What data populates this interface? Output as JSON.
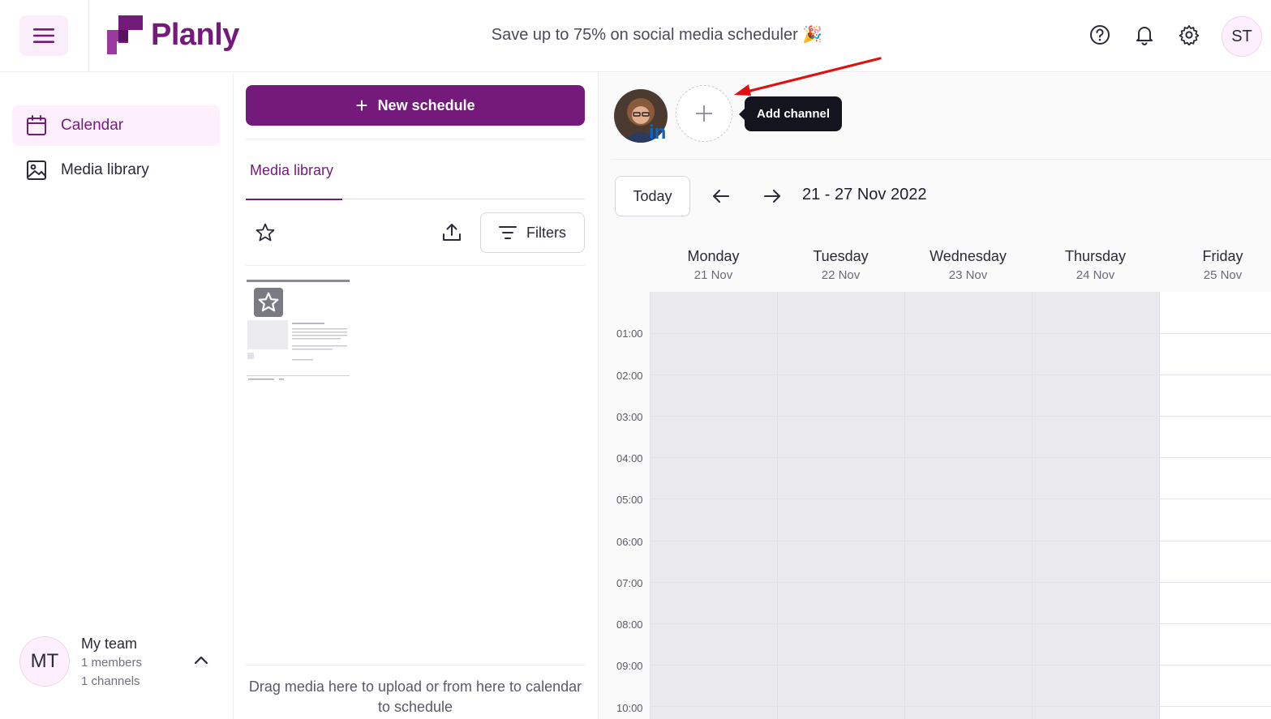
{
  "header": {
    "logo_text": "Planly",
    "promo_text": "Save up to 75% on social media scheduler 🎉",
    "user_initials": "ST",
    "icons": [
      "menu-icon",
      "help-icon",
      "bell-icon",
      "gear-icon"
    ]
  },
  "sidebar": {
    "items": [
      {
        "label": "Calendar",
        "icon": "calendar-icon",
        "active": true
      },
      {
        "label": "Media library",
        "icon": "image-icon",
        "active": false
      }
    ],
    "team": {
      "initials": "MT",
      "name": "My team",
      "members": "1 members",
      "channels": "1 channels"
    }
  },
  "media": {
    "new_schedule_label": "New schedule",
    "tab_label": "Media library",
    "filters_label": "Filters",
    "drop_hint": "Drag media here to upload or from here to calendar to schedule"
  },
  "calendar": {
    "channel_network": "in",
    "add_channel_tooltip": "Add channel",
    "today_label": "Today",
    "range_label": "21 - 27 Nov 2022",
    "days": [
      {
        "name": "Monday",
        "date": "21 Nov"
      },
      {
        "name": "Tuesday",
        "date": "22 Nov"
      },
      {
        "name": "Wednesday",
        "date": "23 Nov"
      },
      {
        "name": "Thursday",
        "date": "24 Nov"
      },
      {
        "name": "Friday",
        "date": "25 Nov"
      }
    ],
    "hours": [
      "01:00",
      "02:00",
      "03:00",
      "04:00",
      "05:00",
      "06:00",
      "07:00",
      "08:00",
      "09:00",
      "10:00"
    ]
  },
  "colors": {
    "brand": "#741a7a",
    "brand_light": "#fdf0fc",
    "tooltip_bg": "#14141e",
    "linkedin": "#0a66c2",
    "annotation_arrow": "#e01010"
  }
}
